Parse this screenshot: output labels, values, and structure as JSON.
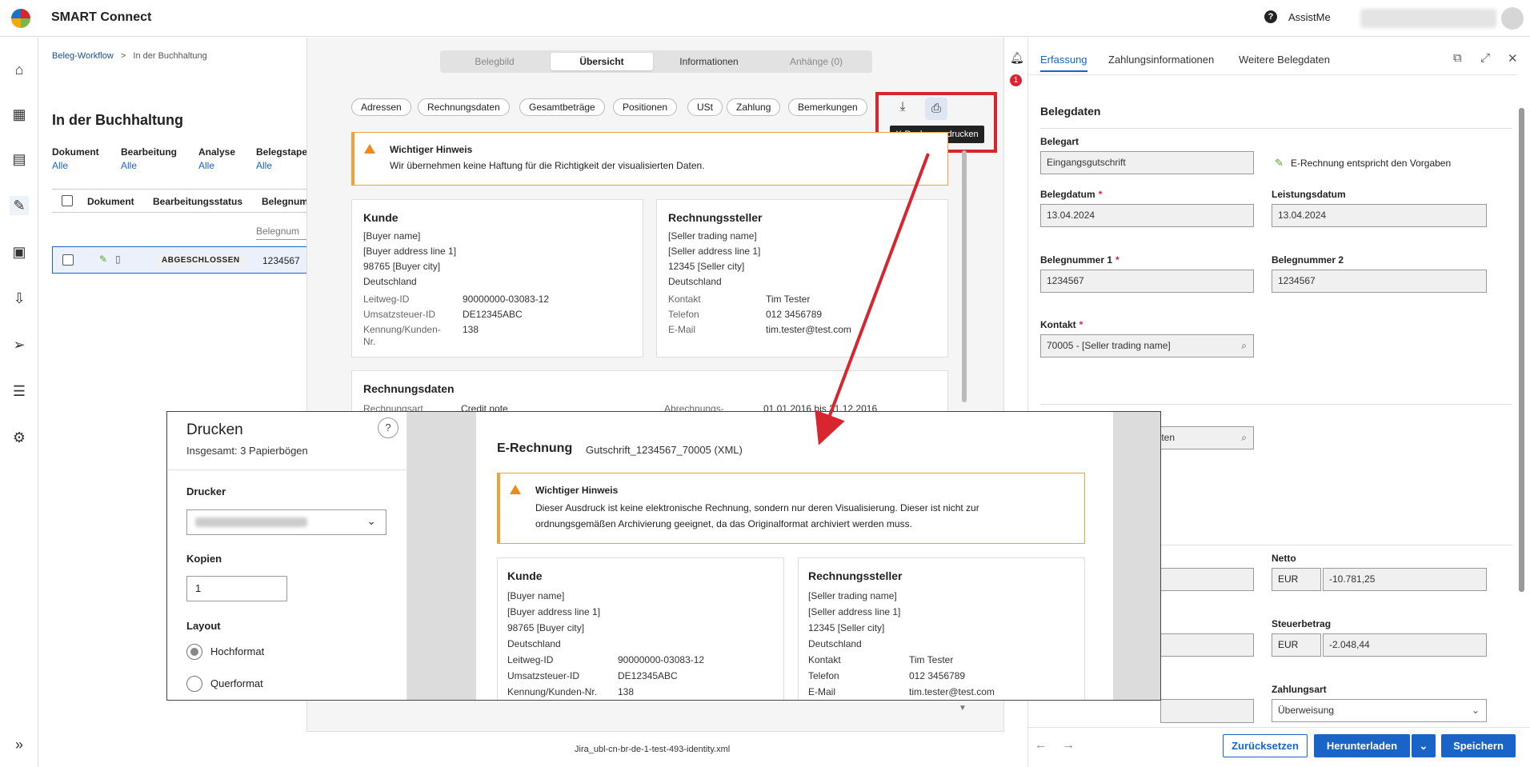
{
  "app": {
    "title": "SMART Connect",
    "assist": "AssistMe"
  },
  "breadcrumb": {
    "root": "Beleg-Workflow",
    "sep": ">",
    "current": "In der Buchhaltung"
  },
  "workflow": {
    "title": "In der Buchhaltung",
    "filters": [
      {
        "label": "Dokument",
        "value": "Alle"
      },
      {
        "label": "Bearbeitung",
        "value": "Alle"
      },
      {
        "label": "Analyse",
        "value": "Alle"
      },
      {
        "label": "Belegstape",
        "value": "Alle"
      }
    ],
    "columns": {
      "doc": "Dokument",
      "status": "Bearbeitungsstatus",
      "num": "Belegnum"
    },
    "filter_placeholder": "Belegnum",
    "row": {
      "status": "ABGESCHLOSSEN",
      "num": "1234567"
    }
  },
  "middle": {
    "tabs": [
      "Belegbild",
      "Übersicht",
      "Informationen",
      "Anhänge (0)"
    ],
    "pills": [
      "Adressen",
      "Rechnungsdaten",
      "Gesamtbeträge",
      "Positionen",
      "USt",
      "Zahlung",
      "Bemerkungen"
    ],
    "tooltip": "X-Rechnung drucken",
    "notice": {
      "title": "Wichtiger Hinweis",
      "body": "Wir übernehmen keine Haftung für die Richtigkeit der visualisierten Daten."
    },
    "kunde": {
      "title": "Kunde",
      "lines": [
        "[Buyer name]",
        "[Buyer address line 1]",
        "98765 [Buyer city]",
        "Deutschland"
      ],
      "kv": [
        [
          "Leitweg-ID",
          "90000000-03083-12"
        ],
        [
          "Umsatzsteuer-ID",
          "DE12345ABC"
        ],
        [
          "Kennung/Kunden-",
          "138"
        ],
        [
          "Nr.",
          ""
        ]
      ]
    },
    "steller": {
      "title": "Rechnungssteller",
      "lines": [
        "[Seller trading name]",
        "[Seller address line 1]",
        "12345 [Seller city]",
        "Deutschland"
      ],
      "kv": [
        [
          "Kontakt",
          "Tim Tester"
        ],
        [
          "Telefon",
          "012 3456789"
        ],
        [
          "E-Mail",
          "tim.tester@test.com"
        ]
      ]
    },
    "rdaten": {
      "title": "Rechnungsdaten",
      "art_label": "Rechnungsart",
      "art_value": "Credit note",
      "abr_label": "Abrechnungs-",
      "abr_value": "01.01.2016 bis 31.12.2016"
    },
    "footer_file": "Jira_ubl-cn-br-de-1-test-493-identity.xml"
  },
  "right": {
    "badge": "1",
    "tabs": [
      "Erfassung",
      "Zahlungsinformationen",
      "Weitere Belegdaten"
    ],
    "section": "Belegdaten",
    "belegart_label": "Belegart",
    "belegart": "Eingangsgutschrift",
    "valid_text": "E-Rechnung entspricht den Vorgaben",
    "belegdatum_label": "Belegdatum",
    "belegdatum": "13.04.2024",
    "leistungsdatum_label": "Leistungsdatum",
    "leistungsdatum": "13.04.2024",
    "belegnummer1_label": "Belegnummer 1",
    "belegnummer1": "1234567",
    "belegnummer2_label": "Belegnummer 2",
    "belegnummer2": "1234567",
    "kontakt_label": "Kontakt",
    "kontakt": "70005 - [Seller trading name]",
    "konten_partial": "onten",
    "netto_label": "Netto",
    "netto_cur": "EUR",
    "netto": "-10.781,25",
    "steuer_label": "Steuerbetrag",
    "steuer_cur": "EUR",
    "steuer": "-2.048,44",
    "zahlungsart_label": "Zahlungsart",
    "zahlungsart": "Überweisung",
    "buttons": {
      "reset": "Zurücksetzen",
      "download": "Herunterladen",
      "save": "Speichern"
    }
  },
  "print": {
    "title": "Drucken",
    "subtitle": "Insgesamt: 3 Papierbögen",
    "help": "?",
    "printer_label": "Drucker",
    "copies_label": "Kopien",
    "copies": "1",
    "layout_label": "Layout",
    "portrait": "Hochformat",
    "landscape": "Querformat",
    "preview": {
      "heading": "E-Rechnung",
      "file": "Gutschrift_1234567_70005 (XML)",
      "notice_title": "Wichtiger Hinweis",
      "notice_line1": "Dieser Ausdruck ist keine elektronische Rechnung, sondern nur deren Visualisierung. Dieser ist nicht zur",
      "notice_line2": "ordnungsgemäßen Archivierung geeignet, da das Originalformat archiviert werden muss.",
      "kunde_title": "Kunde",
      "kunde_lines": [
        "[Buyer name]",
        "[Buyer address line 1]",
        "98765 [Buyer city]",
        "Deutschland"
      ],
      "kunde_kv": [
        [
          "Leitweg-ID",
          "90000000-03083-12"
        ],
        [
          "Umsatzsteuer-ID",
          "DE12345ABC"
        ],
        [
          "Kennung/Kunden-Nr.",
          "138"
        ]
      ],
      "steller_title": "Rechnungssteller",
      "steller_lines": [
        "[Seller trading name]",
        "[Seller address line 1]",
        "12345 [Seller city]",
        "Deutschland"
      ],
      "steller_kv": [
        [
          "Kontakt",
          "Tim Tester"
        ],
        [
          "Telefon",
          "012 3456789"
        ],
        [
          "E-Mail",
          "tim.tester@test.com"
        ]
      ]
    }
  },
  "colors": {
    "accent": "#1a64c8",
    "highlight": "#d7262f",
    "warning": "#f0a23a"
  }
}
